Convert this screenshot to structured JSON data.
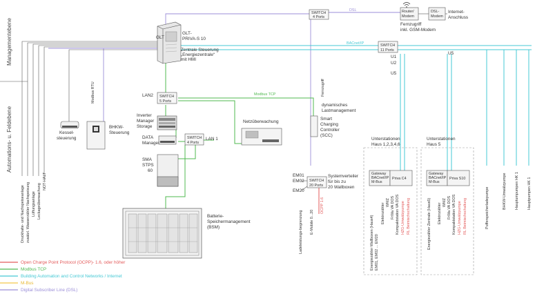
{
  "side_labels": {
    "management": "Managementebene",
    "automation": "Automations- u. Feldebene"
  },
  "network_labels": {
    "dsl": "DSL",
    "bacnet": "BACnet/IP",
    "modbus_tcp": "Modbus TCP",
    "modbus_rtu": "Modbus RTU",
    "fernzugriff": "Fernzugriff"
  },
  "nodes": {
    "switch_top": [
      "SWITCH",
      "4 Ports"
    ],
    "router": [
      "Router/",
      "Modem"
    ],
    "dsl_modem": [
      "DSL-",
      "Modem"
    ],
    "internet": [
      "Internet-",
      "Anschluss"
    ],
    "fernzugriff_note": [
      "Fernzugriff",
      "inkl. GSM-Modem"
    ],
    "glt_cabinet": "GLT",
    "glt_desc": [
      "GLT-",
      "PRIVA-S 10"
    ],
    "glt_desc2": [
      "Zentrale Steuerung",
      "„Energiezentrale“",
      "mit HMI"
    ],
    "switch_bacnet": [
      "SWITCH",
      "11 Ports"
    ],
    "u_labels": [
      "U1",
      "U2",
      "U5",
      "U5"
    ],
    "lan2": "LAN2",
    "switch_lan2": [
      "SWITCH",
      "5 Ports"
    ],
    "inverter": [
      "Inverter",
      "Manager",
      "Storage"
    ],
    "data_manager": [
      "DATA",
      "Manager"
    ],
    "switch_lan1": [
      "SWITCH",
      "4 Ports"
    ],
    "lan1": "LAN 1",
    "sma": [
      "SMA",
      "STPS",
      "60"
    ],
    "battery": [
      "Batterie-",
      "Speichermanagement",
      "(BSM)"
    ],
    "netz": "Netzüberwachung",
    "dyn_last": [
      "dynamisches",
      "Lastmanagement"
    ],
    "scc": [
      "Smart",
      "Charging",
      "Controller",
      "(SCC)"
    ],
    "kessel": [
      "Kessel-",
      "steuerung"
    ],
    "bhkw": [
      "BHKW-",
      "Steuerung"
    ],
    "em01": "EM01",
    "em02": "EM02",
    "em20": "EM20",
    "switch_em": [
      "SWITCH",
      "20 Ports"
    ],
    "systemverteiler": [
      "Systemverteiler",
      "für bis zu",
      "20 Wallboxen"
    ],
    "ladeleistung": "Ladeleistungs-begrenzung",
    "emobile": "E-Mobile 0...20",
    "ocpp": "OCPP 1.6",
    "unterstation1": [
      "Unterstationen",
      "Haus 1,2,3,4,6"
    ],
    "unterstation2": [
      "Unterstationen",
      "Haus 5"
    ],
    "gateway1": [
      "Gateway",
      "BACnet/IP",
      "M-Bus"
    ],
    "priva_c4": "Priva C4",
    "gateway2": [
      "Gateway",
      "BACnet/IP",
      "M-Bus"
    ],
    "priva_s10": "Priva S10"
  },
  "left_vertical_labels": [
    "Druckhalte- und Nachspeiseanlage",
    "zusätzl. Wasserzähler Nachspeisung",
    "Lüftungsanlage",
    "Leckageüberwachung",
    "NOT-HALT"
  ],
  "house1_vertical": {
    "black": [
      "Energiezähler Wallboxen (Haus4)",
      "EM01, EM02 ... EM20",
      "Elektrozähler",
      "WMZ",
      "FrWa  VA DOS",
      "Kompaktstation VA DOS"
    ],
    "red": [
      "HZG-Umwälzpumpe",
      "RL Beimischschaltung"
    ]
  },
  "house5_vertical": {
    "black": [
      "Energiezähler Zentrale (Haus5)",
      "Elektrozähler",
      "WMZ",
      "FrWa  VA DOS",
      "Kompaktstation VA DOS"
    ],
    "red": [
      "HZG-Umwälzpumpe",
      "RL Beimischschaltung"
    ]
  },
  "right_vertical_labels": [
    "Pufferspeicherladepumpe",
    "BHKW-Umwälzpumpe",
    "Hauptumpumpen HK 1",
    "Hauptpumpen HK 1"
  ],
  "legend": [
    {
      "label": "Open Charge Point Protocol (OCPP)- 1.6, oder höher",
      "color": "#e35a5a"
    },
    {
      "label": "Modbus TCP",
      "color": "#4fb84f"
    },
    {
      "label": "Building Automation and Control Networks / Internet",
      "color": "#44c8d4"
    },
    {
      "label": "M-Bus",
      "color": "#f2c84b"
    },
    {
      "label": "Digital Subscriber Line (DSL)",
      "color": "#9b8ed8"
    }
  ]
}
